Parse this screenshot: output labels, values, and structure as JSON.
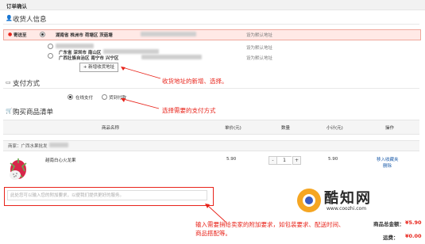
{
  "header": {
    "title": "订单确认"
  },
  "address_section": {
    "title": "收货人信息",
    "addresses": [
      {
        "label": "寄送至",
        "region": "湖南省 株洲市 荷塘区 茨菇塘",
        "set_default": "设为默认地址",
        "selected": true
      },
      {
        "label": "",
        "region": "广东省 深圳市 南山区",
        "set_default": "设为默认地址",
        "selected": false
      },
      {
        "label": "",
        "region": "广西壮族自治区 南宁市 兴宁区",
        "set_default": "设为默认地址",
        "selected": false
      }
    ],
    "add_button": "新增收货地址"
  },
  "payment_section": {
    "title": "支付方式",
    "options": [
      {
        "label": "在线支付",
        "selected": true
      },
      {
        "label": "货到付款",
        "selected": false
      }
    ]
  },
  "goods_section": {
    "title": "购买商品清单",
    "columns": [
      "商品名称",
      "单价(元)",
      "数量",
      "小计(元)",
      "操作"
    ],
    "shop_label": "商家：广西水果批发",
    "items": [
      {
        "name": "越南白心火龙果",
        "price": "5.90",
        "quantity": "1",
        "subtotal": "5.90",
        "actions": [
          "移入收藏夹",
          "删除"
        ]
      }
    ],
    "message_placeholder": "此处您可以输入您的附加要求，以便我们提供更好的服务。"
  },
  "annotations": {
    "address": "收货地址的新增、选择。",
    "payment": "选择需要的支付方式",
    "message_line1": "输入需要捎给卖家的附加要求，如包装要求、配送时间、",
    "message_line2": "商品搭配等。"
  },
  "totals": {
    "goods_total_label": "商品总金额：",
    "goods_total": "¥5.90",
    "shipping_label": "运费：",
    "shipping": "¥0.00"
  },
  "watermark": {
    "name": "酷知网",
    "url": "www.coozhi.com"
  },
  "colors": {
    "accent_red": "#e8231a",
    "link_blue": "#1a5aa8",
    "highlight_bg": "#ffe9e6"
  }
}
